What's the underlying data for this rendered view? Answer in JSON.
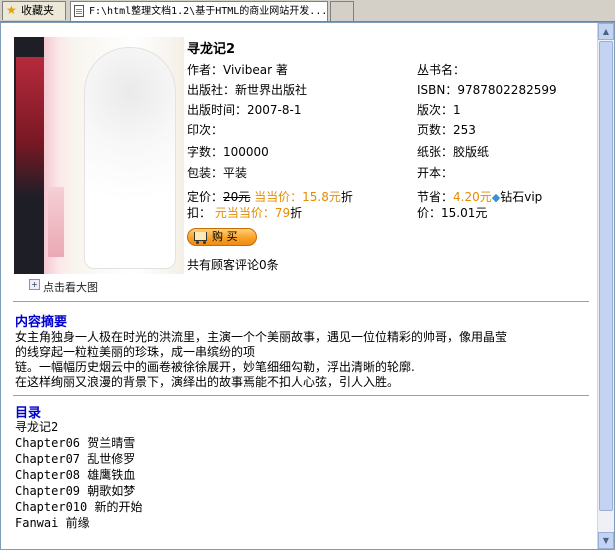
{
  "tabs": {
    "favorites": "收藏夹",
    "page_title": "F:\\html整理文档1.2\\基于HTML的商业网站开发..."
  },
  "book": {
    "title": "寻龙记2",
    "cover_caption": "点击看大图",
    "author": "作者：Vivibear 著",
    "publisher": "出版社：新世界出版社",
    "pub_date": "出版时间：2007-8-1",
    "impression": "印次：",
    "word_count": "字数：100000",
    "binding": "包装：平装",
    "series": "丛书名：",
    "isbn": "ISBN：9787802282599",
    "edition": "版次：1",
    "pages": "页数：253",
    "paper": "纸张：胶版纸",
    "format": "开本：",
    "price_label": "定价：",
    "price_orig": "20元",
    "dd_price": "当当价：15.8元",
    "discount_suffix": "折",
    "discount_prefix": "扣：",
    "dd_discount": "元当当价：79",
    "discount_suffix2": "折",
    "save_label": "节省：",
    "save_amount": "4.20元",
    "vip_label": "钻石vip",
    "vip_price": "价：15.01元",
    "buy_label": "购 买",
    "reviews": "共有顾客评论0条"
  },
  "summary": {
    "heading": "内容摘要",
    "lines": [
      "女主角独身一人极在时光的洪流里，主演一个个美丽故事，遇见一位位精彩的帅哥，像用晶莹",
      "的线穿起一粒粒美丽的珍珠，成一串缤纷的项",
      "链。一幅幅历史烟云中的画卷被徐徐展开，妙笔细细勾勒，浮出清晰的轮廓.",
      "在这样绚丽又浪漫的背景下，演绎出的故事焉能不扣人心弦，引人入胜。"
    ]
  },
  "toc": {
    "heading": "目录",
    "items": [
      "寻龙记2",
      "Chapter06 贺兰晴雪",
      "Chapter07 乱世修罗",
      "Chapter08 雄鹰铁血",
      "Chapter09 朝歌如梦",
      "Chapter010 新的开始",
      "Fanwai 前缘"
    ]
  },
  "icons": {
    "favorites": "star-icon",
    "page": "document-icon",
    "zoom": "magnify-icon",
    "cart": "cart-icon",
    "vip": "diamond-icon"
  },
  "colors": {
    "heading": "#0000cc",
    "price_highlight": "#e58c00",
    "buy_button": "#f9a12a"
  }
}
